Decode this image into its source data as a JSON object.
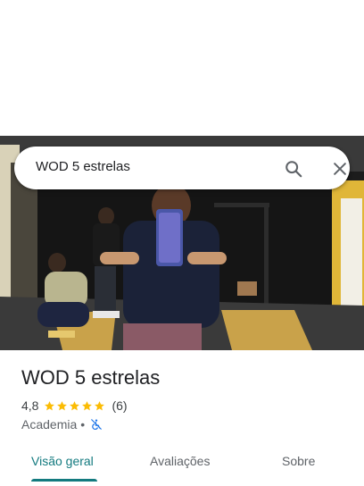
{
  "search": {
    "query": "WOD 5 estrelas"
  },
  "place": {
    "title": "WOD 5 estrelas",
    "rating": "4,8",
    "stars": 5,
    "review_count": "(6)",
    "category": "Academia",
    "separator": "•"
  },
  "tabs": [
    {
      "label": "Visão geral",
      "active": true
    },
    {
      "label": "Avaliações",
      "active": false
    },
    {
      "label": "Sobre",
      "active": false
    }
  ],
  "colors": {
    "accent": "#137a7f",
    "star": "#fbbc04"
  },
  "icons": {
    "search": "search-icon",
    "close": "close-icon",
    "accessibility": "wheelchair-not-accessible-icon"
  }
}
